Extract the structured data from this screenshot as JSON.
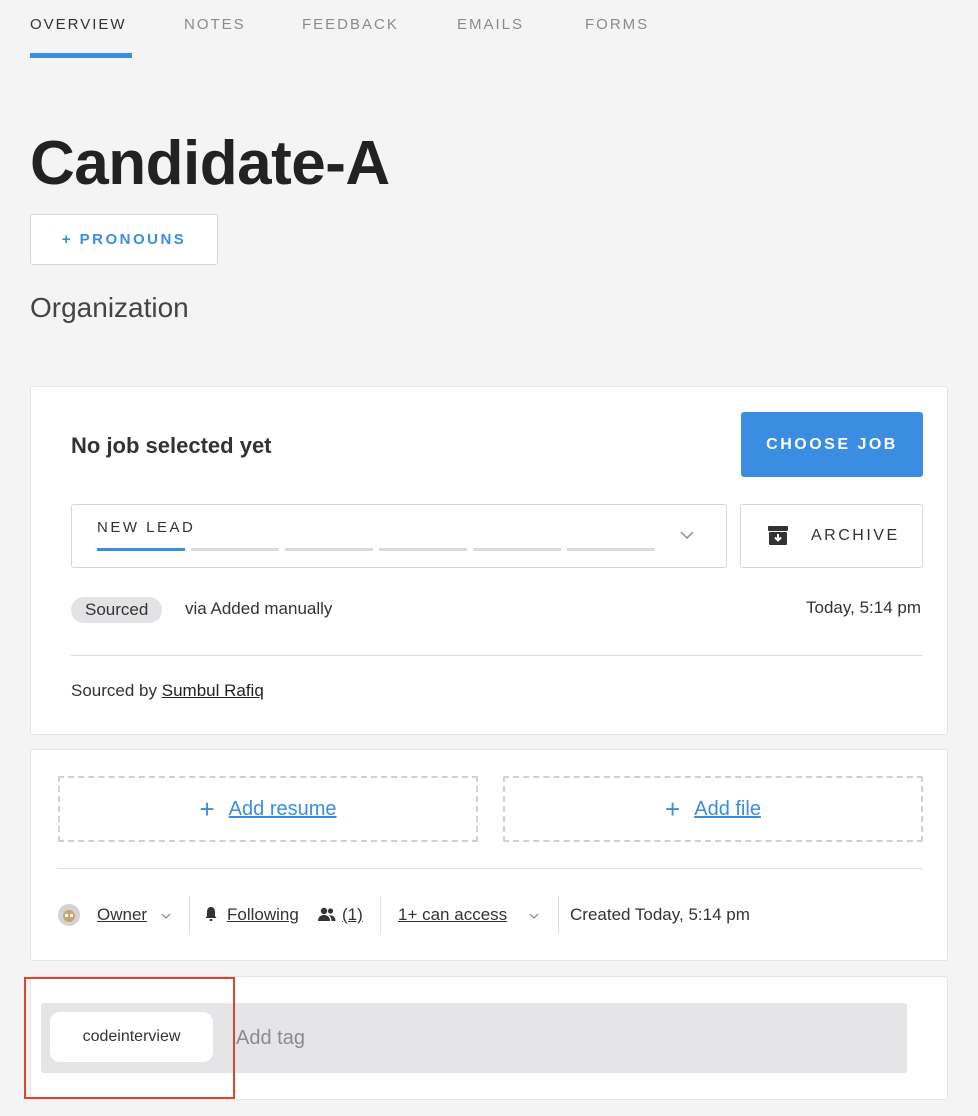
{
  "tabs": [
    {
      "label": "OVERVIEW",
      "active": true
    },
    {
      "label": "NOTES",
      "active": false
    },
    {
      "label": "FEEDBACK",
      "active": false
    },
    {
      "label": "EMAILS",
      "active": false
    },
    {
      "label": "FORMS",
      "active": false
    }
  ],
  "candidate": {
    "name": "Candidate-A",
    "pronouns_button": "+ PRONOUNS",
    "organization": "Organization"
  },
  "job_card": {
    "heading": "No job selected yet",
    "choose_job_label": "CHOOSE JOB",
    "stage_label": "NEW LEAD",
    "archive_label": "ARCHIVE",
    "source_badge": "Sourced",
    "source_via": "via Added manually",
    "source_time": "Today, 5:14 pm",
    "sourced_by_prefix": "Sourced by",
    "sourced_by_name": "Sumbul Rafiq"
  },
  "files_card": {
    "add_resume": "Add resume",
    "add_file": "Add file",
    "owner_label": "Owner",
    "following_label": "Following",
    "followers_count": "(1)",
    "access_label": "1+ can access",
    "created_label": "Created Today, 5:14 pm"
  },
  "tags_card": {
    "tags": [
      "codeinterview"
    ],
    "add_tag_placeholder": "Add tag"
  },
  "colors": {
    "accent": "#3a8de0",
    "highlight": "#e2412c"
  }
}
